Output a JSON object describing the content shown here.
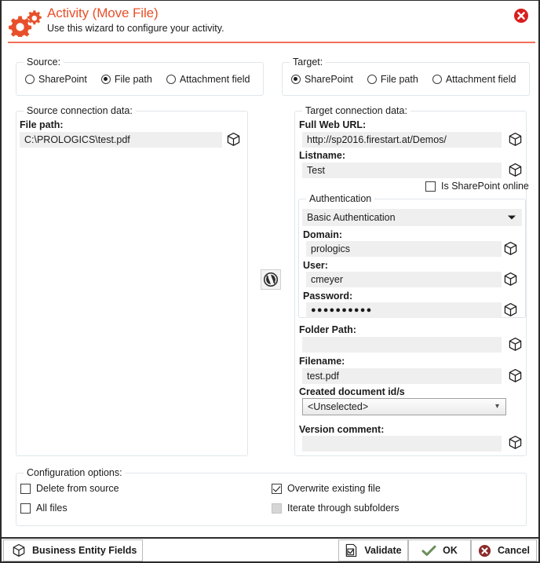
{
  "header": {
    "title": "Activity (Move File)",
    "subtitle": "Use this wizard to configure your activity.",
    "gear_icon": "gears-icon",
    "close_icon": "close-icon",
    "accent_color": "#e8502a",
    "rule_color": "#f2705a"
  },
  "source": {
    "group_title": "Source:",
    "options": [
      {
        "label": "SharePoint",
        "selected": false
      },
      {
        "label": "File path",
        "selected": true
      },
      {
        "label": "Attachment field",
        "selected": false
      }
    ],
    "connection": {
      "group_title": "Source connection data:",
      "file_path_label": "File path:",
      "file_path_value": "C:\\PROLOGICS\\test.pdf",
      "file_path_entity_icon": "cube-icon"
    }
  },
  "target": {
    "group_title": "Target:",
    "options": [
      {
        "label": "SharePoint",
        "selected": true
      },
      {
        "label": "File path",
        "selected": false
      },
      {
        "label": "Attachment field",
        "selected": false
      }
    ],
    "connection": {
      "group_title": "Target connection data:",
      "full_web_url_label": "Full Web URL:",
      "full_web_url_value": "http://sp2016.firestart.at/Demos/",
      "listname_label": "Listname:",
      "listname_value": "Test",
      "is_sharepoint_online_label": "Is SharePoint online",
      "is_sharepoint_online_checked": false,
      "authentication": {
        "group_title": "Authentication",
        "mode_value": "Basic Authentication",
        "domain_label": "Domain:",
        "domain_value": "prologics",
        "user_label": "User:",
        "user_value": "cmeyer",
        "password_label": "Password:",
        "password_value": "●●●●●●●●●●"
      },
      "folder_path_label": "Folder Path:",
      "folder_path_value": "",
      "filename_label": "Filename:",
      "filename_value": "test.pdf",
      "created_document_ids_label": "Created document id/s",
      "created_document_ids_value": "<Unselected>",
      "version_comment_label": "Version comment:",
      "version_comment_value": ""
    }
  },
  "swap": {
    "icon": "swap-circular-arrows-icon"
  },
  "configuration": {
    "group_title": "Configuration options:",
    "items": [
      {
        "label": "Delete from source",
        "checked": false,
        "disabled": false
      },
      {
        "label": "All files",
        "checked": false,
        "disabled": false
      },
      {
        "label": "Overwrite existing file",
        "checked": true,
        "disabled": false
      },
      {
        "label": "Iterate through subfolders",
        "checked": false,
        "disabled": true
      }
    ]
  },
  "bottom_bar": {
    "business_entity_fields": {
      "label": "Business Entity Fields",
      "icon": "cube-icon"
    },
    "validate": {
      "label": "Validate",
      "icon": "validate-document-icon"
    },
    "ok": {
      "label": "OK",
      "icon": "check-icon",
      "color": "#6b8e5a"
    },
    "cancel": {
      "label": "Cancel",
      "icon": "cancel-circle-icon",
      "color": "#8b2b2b"
    }
  }
}
